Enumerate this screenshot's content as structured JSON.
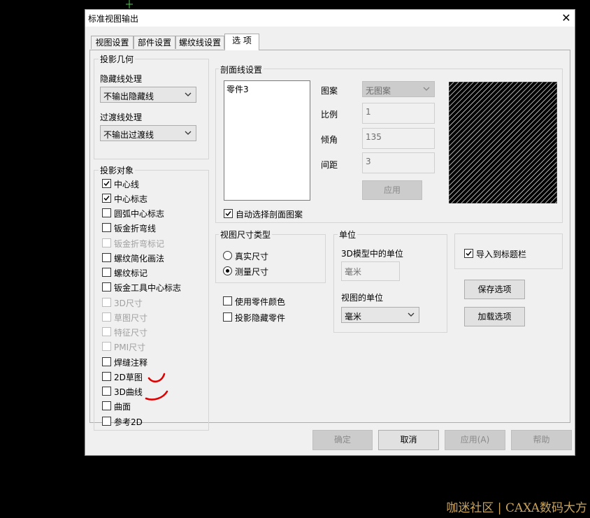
{
  "dialog": {
    "title": "标准视图输出",
    "close": "✕"
  },
  "tabs": [
    {
      "label": "视图设置"
    },
    {
      "label": "部件设置"
    },
    {
      "label": "螺纹线设置"
    },
    {
      "label": "选 项"
    }
  ],
  "projection_geometry": {
    "title": "投影几何",
    "hidden_label": "隐藏线处理",
    "hidden_value": "不输出隐藏线",
    "transition_label": "过渡线处理",
    "transition_value": "不输出过渡线"
  },
  "projection_objects": {
    "title": "投影对象",
    "items": [
      {
        "label": "中心线",
        "checked": true,
        "enabled": true
      },
      {
        "label": "中心标志",
        "checked": true,
        "enabled": true
      },
      {
        "label": "圆弧中心标志",
        "checked": false,
        "enabled": true
      },
      {
        "label": "钣金折弯线",
        "checked": false,
        "enabled": true
      },
      {
        "label": "钣金折弯标记",
        "checked": false,
        "enabled": false
      },
      {
        "label": "螺纹简化画法",
        "checked": false,
        "enabled": true
      },
      {
        "label": "螺纹标记",
        "checked": false,
        "enabled": true
      },
      {
        "label": "钣金工具中心标志",
        "checked": false,
        "enabled": true
      },
      {
        "label": "3D尺寸",
        "checked": false,
        "enabled": false
      },
      {
        "label": "草图尺寸",
        "checked": false,
        "enabled": false
      },
      {
        "label": "特征尺寸",
        "checked": false,
        "enabled": false
      },
      {
        "label": "PMI尺寸",
        "checked": false,
        "enabled": false
      },
      {
        "label": "焊缝注释",
        "checked": false,
        "enabled": true
      },
      {
        "label": "2D草图",
        "checked": false,
        "enabled": true
      },
      {
        "label": "3D曲线",
        "checked": false,
        "enabled": true
      },
      {
        "label": "曲面",
        "checked": false,
        "enabled": true
      },
      {
        "label": "参考2D",
        "checked": false,
        "enabled": true
      }
    ]
  },
  "section": {
    "title": "剖面线设置",
    "list_items": [
      "零件3"
    ],
    "pattern_label": "图案",
    "pattern_value": "无图案",
    "scale_label": "比例",
    "scale_value": "1",
    "angle_label": "倾角",
    "angle_value": "135",
    "spacing_label": "间距",
    "spacing_value": "3",
    "apply_label": "应用",
    "auto_label": "自动选择剖面图案",
    "auto_checked": true
  },
  "dim_type": {
    "title": "视图尺寸类型",
    "options": [
      {
        "label": "真实尺寸",
        "selected": false
      },
      {
        "label": "测量尺寸",
        "selected": true
      }
    ]
  },
  "units": {
    "title": "单位",
    "model_label": "3D模型中的单位",
    "model_value": "毫米",
    "view_label": "视图的单位",
    "view_value": "毫米"
  },
  "misc": {
    "use_part_color": "使用零件颜色",
    "project_hidden_parts": "投影隐藏零件",
    "import_titlebar": "导入到标题栏",
    "import_checked": true,
    "save_options": "保存选项",
    "load_options": "加载选项"
  },
  "footer": {
    "ok": "确定",
    "cancel": "取消",
    "apply": "应用(A)",
    "help": "帮助"
  },
  "watermark": "咖迷社区 | CAXA数码大方",
  "colors": {
    "annotation": "#e00000",
    "watermark": "#c9a35a"
  }
}
